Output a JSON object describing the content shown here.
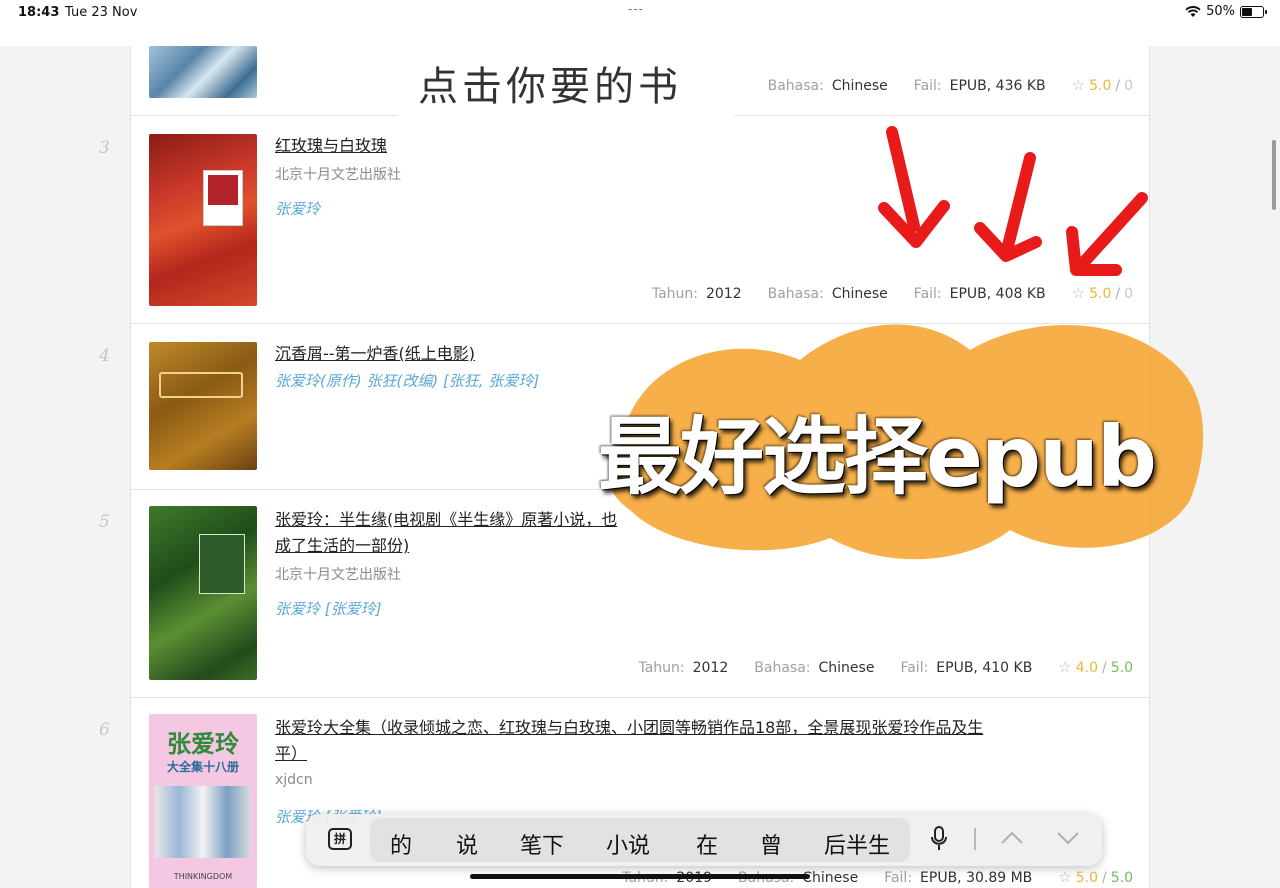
{
  "status_bar": {
    "time": "18:43",
    "date": "Tue 23 Nov",
    "battery": "50%",
    "dots": "---"
  },
  "caption": "点击你要的书",
  "overlay_text": "最好选择epub",
  "labels": {
    "year": "Tahun:",
    "language": "Bahasa:",
    "file": "Fail:"
  },
  "rows": [
    {
      "num": "",
      "language": "Chinese",
      "file": "EPUB, 436 KB",
      "rating": "5.0",
      "rating_sep": "/",
      "votes": "0"
    },
    {
      "num": "3",
      "title": "红玫瑰与白玫瑰",
      "publisher": "北京十月文艺出版社",
      "author": "张爱玲",
      "year": "2012",
      "language": "Chinese",
      "file": "EPUB, 408 KB",
      "rating": "5.0",
      "rating_sep": "/",
      "votes": "0"
    },
    {
      "num": "4",
      "title": "沉香屑--第一炉香(纸上电影)",
      "author": "张爱玲(原作) 张狂(改编) [张狂, 张爱玲]"
    },
    {
      "num": "5",
      "title_line1": "张爱玲：半生缘(电视剧《半生缘》原著小说，也",
      "title_line2": "成了生活的一部份)",
      "publisher": "北京十月文艺出版社",
      "author": "张爱玲 [张爱玲]",
      "year": "2012",
      "language": "Chinese",
      "file": "EPUB, 410 KB",
      "rating": "4.0",
      "rating_sep": "/",
      "votes": "5.0"
    },
    {
      "num": "6",
      "title_line1": "张爱玲大全集（收录倾城之恋、红玫瑰与白玫瑰、小团圆等畅销作品18部，全景展现张爱玲作品及生",
      "title_line2": "平）",
      "publisher": "xjdcn",
      "author": "张爱玲 [张爱玲]",
      "year": "2019",
      "language": "Chinese",
      "file": "EPUB, 30.89 MB",
      "rating": "5.0",
      "rating_sep": "/",
      "votes": "5.0",
      "cover_title": "张爱玲",
      "cover_subtitle": "大全集十八册",
      "cover_brand": "THINKINGDOM"
    }
  ],
  "keyboard": {
    "pinyin_key": "拼",
    "candidates": [
      "的",
      "说",
      "笔下",
      "小说",
      "在",
      "曾",
      "后半生"
    ]
  }
}
